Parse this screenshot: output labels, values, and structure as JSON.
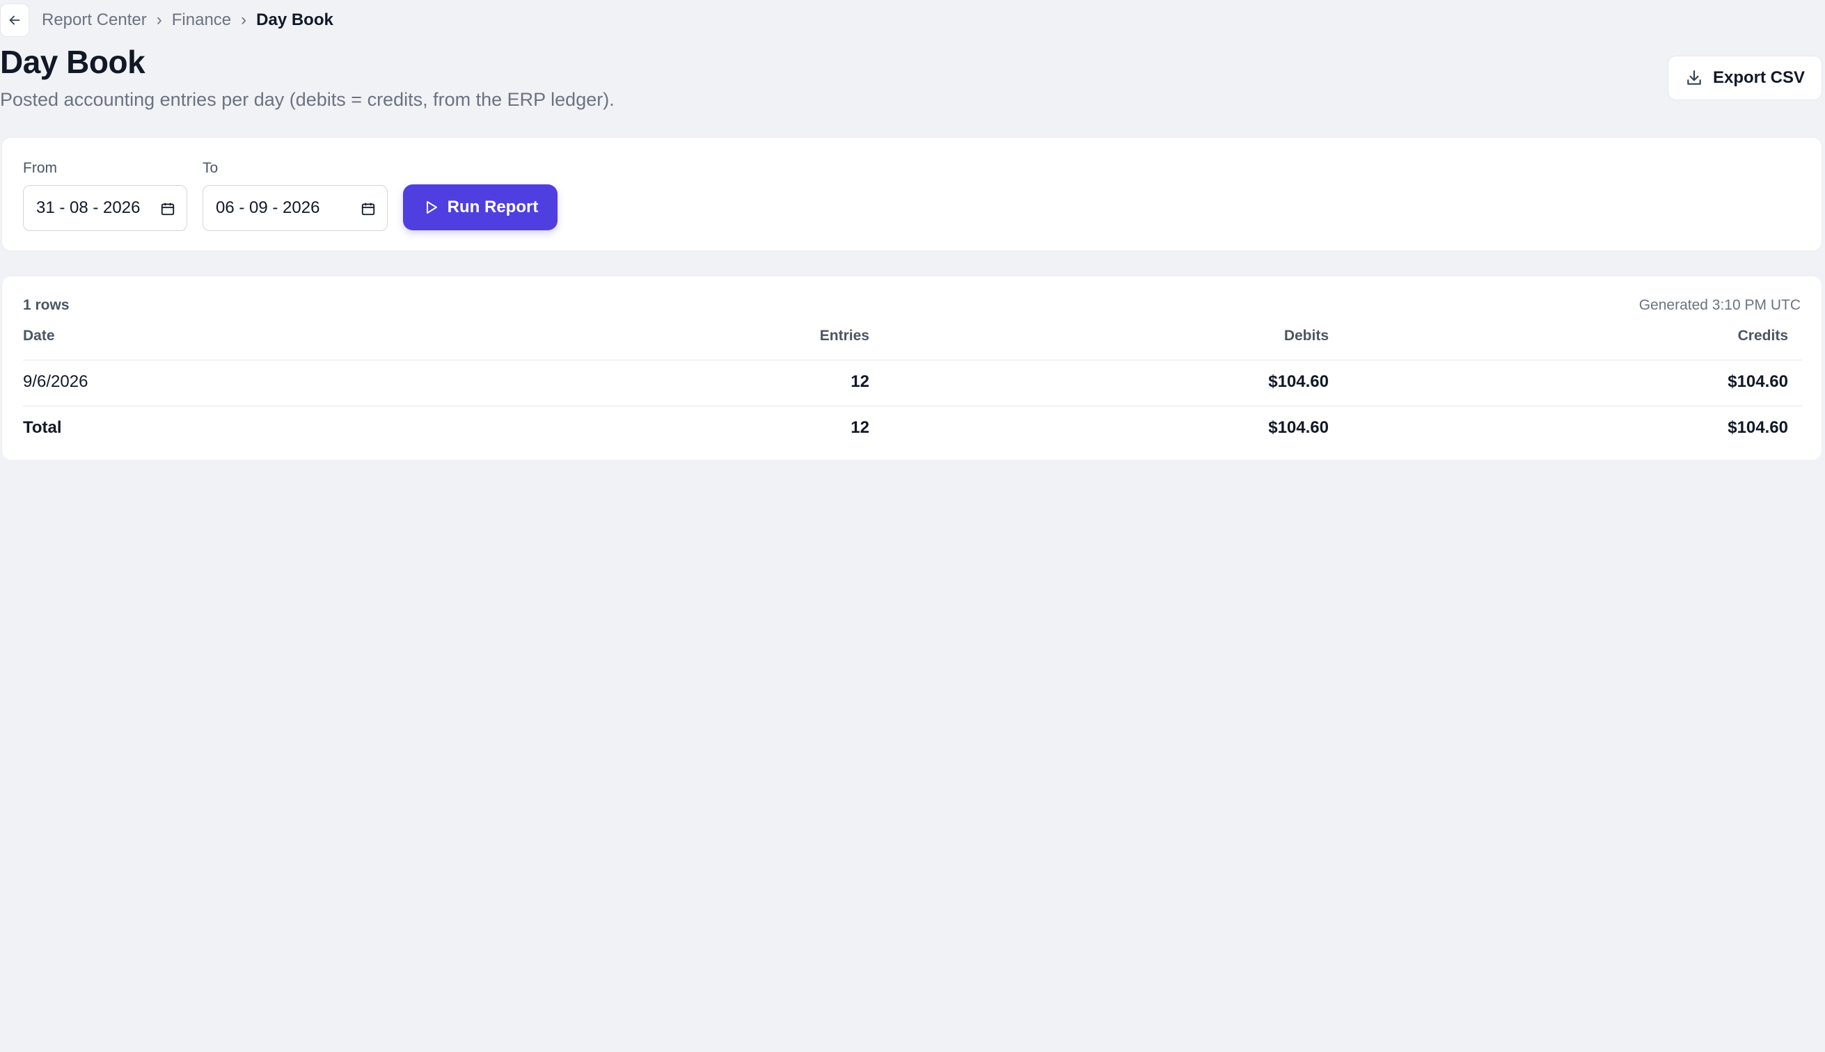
{
  "breadcrumb": {
    "items": [
      "Report Center",
      "Finance",
      "Day Book"
    ],
    "separator": "›"
  },
  "header": {
    "title": "Day Book",
    "subtitle": "Posted accounting entries per day (debits = credits, from the ERP ledger).",
    "export_label": "Export CSV"
  },
  "filters": {
    "from_label": "From",
    "from_value": "31 - 08 - 2026",
    "to_label": "To",
    "to_value": "06 - 09 - 2026",
    "run_label": "Run Report"
  },
  "report": {
    "rows_count": "1 rows",
    "generated": "Generated 3:10 PM UTC",
    "columns": [
      "Date",
      "Entries",
      "Debits",
      "Credits"
    ],
    "rows": [
      [
        "9/6/2026",
        "12",
        "$104.60",
        "$104.60"
      ]
    ],
    "total": [
      "Total",
      "12",
      "$104.60",
      "$104.60"
    ]
  },
  "colors": {
    "accent": "#4f3fe0",
    "background": "#f1f2f6"
  }
}
